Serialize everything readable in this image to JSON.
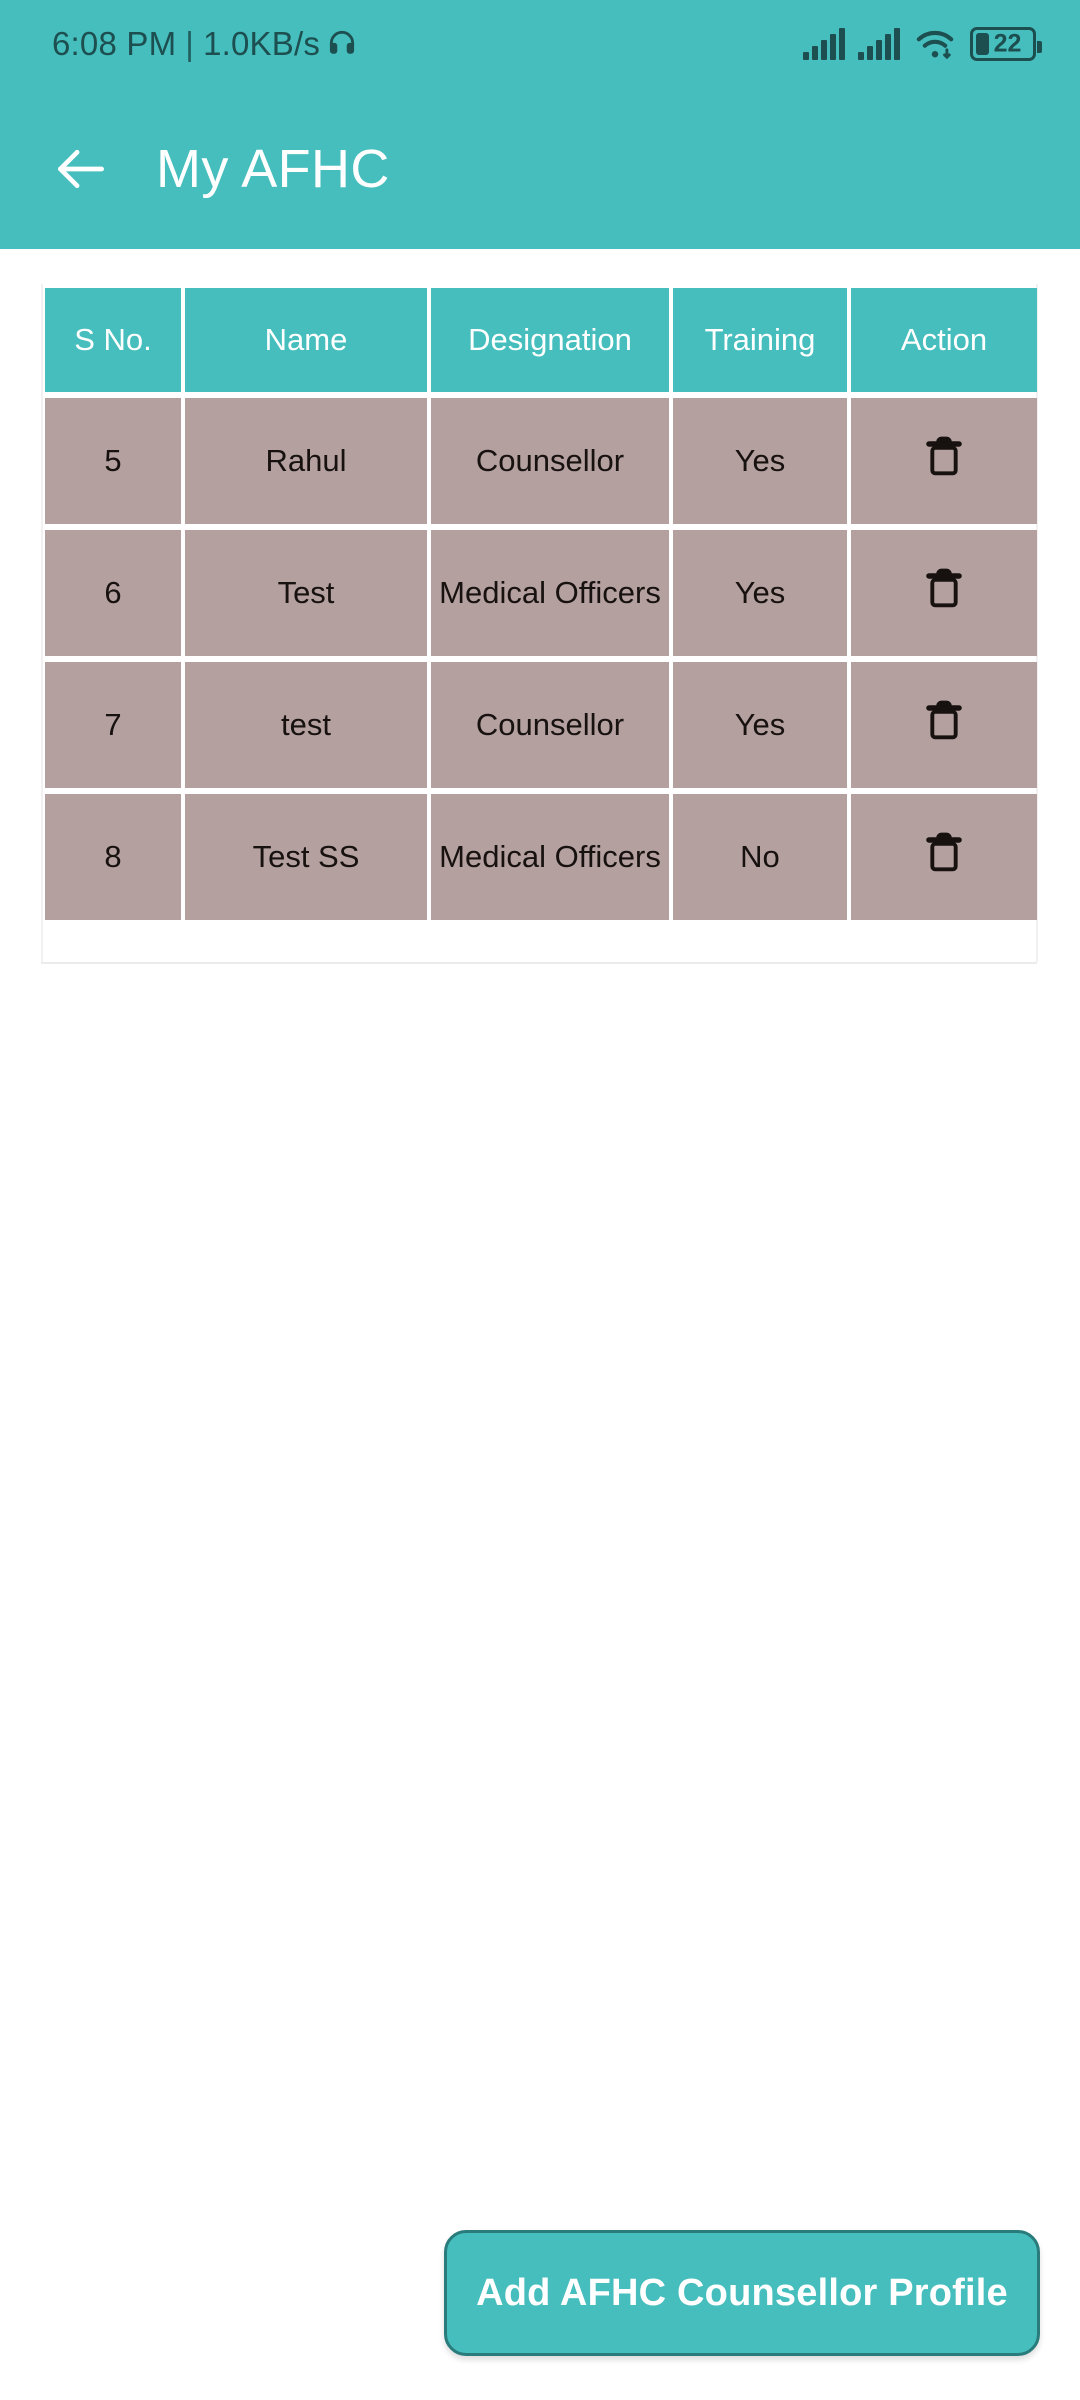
{
  "status_bar": {
    "time": "6:08 PM",
    "separator": "|",
    "network_speed": "1.0KB/s",
    "headset_icon": "headset-icon",
    "signal_icon_1": "signal-bars-icon",
    "signal_icon_2": "signal-bars-icon",
    "wifi_icon": "wifi-icon",
    "battery_icon": "battery-icon",
    "battery_level": "22"
  },
  "app_bar": {
    "back_icon": "arrow-left-icon",
    "title": "My AFHC"
  },
  "table": {
    "columns": [
      {
        "key": "sno",
        "label": "S No."
      },
      {
        "key": "name",
        "label": "Name"
      },
      {
        "key": "desig",
        "label": "Designation"
      },
      {
        "key": "train",
        "label": "Training"
      },
      {
        "key": "act",
        "label": "Action"
      }
    ],
    "rows": [
      {
        "sno": "5",
        "name": "Rahul",
        "desig": "Counsellor",
        "train": "Yes",
        "action_icon": "trash-icon"
      },
      {
        "sno": "6",
        "name": "Test",
        "desig": "Medical Officers",
        "train": "Yes",
        "action_icon": "trash-icon"
      },
      {
        "sno": "7",
        "name": "test",
        "desig": "Counsellor",
        "train": "Yes",
        "action_icon": "trash-icon"
      },
      {
        "sno": "8",
        "name": "Test SS",
        "desig": "Medical Officers",
        "train": "No",
        "action_icon": "trash-icon"
      }
    ]
  },
  "footer": {
    "add_button_label": "Add AFHC Counsellor Profile"
  },
  "colors": {
    "accent_teal": "#45BEBD",
    "cell_mauve": "#B3A09F",
    "button_border": "#2a7b7c",
    "status_icon": "#1d4f50",
    "page_background": "#ffffff"
  }
}
